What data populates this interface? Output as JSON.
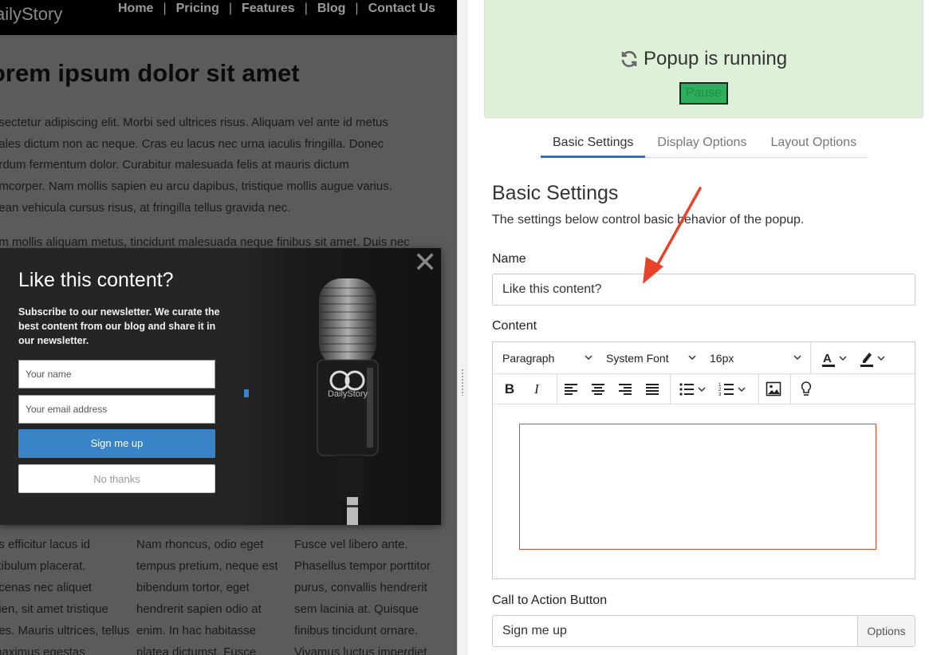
{
  "preview": {
    "logo": "ailyStory",
    "nav": [
      "Home",
      "Pricing",
      "Features",
      "Blog",
      "Contact Us"
    ],
    "nav_separator": "|",
    "article_title": "orem ipsum dolor sit amet",
    "p1_lines": [
      "nsectetur adipiscing elit. Morbi sed ultrices risus. Aliquam vel ante id metus",
      "dales dictum non ac neque. Cras eu lacus nec urna iaculis fringilla. Donec",
      "erdum fermentum dolor. Curabitur malesuada felis at mauris dictum",
      "amcorper. Nam mollis sapien eu arcu dapibus, tristique mollis augue varius.",
      "nean vehicula cursus risus, at fringilla tellus gravida nec."
    ],
    "p2_lines": [
      "am mollis aliquam metus, tincidunt malesuada neque finibus sit amet. Duis nec"
    ],
    "col1_lines": [
      "as efficitur lacus id",
      "stibulum placerat.",
      "ecenas nec aliquet",
      "pien, sit amet tristique",
      "pes. Mauris ultrices, tellus",
      "maximus egestas"
    ],
    "col2_lines": [
      "Nam rhoncus, odio eget",
      "tempus pretium, neque est",
      "bibendum tortor, eget",
      "hendrerit sapien odio at",
      "enim. In hac habitasse",
      "platea dictumst. Fusce"
    ],
    "col3_lines": [
      "Fusce vel libero ante.",
      "Phasellus tempor porttitor",
      "purus, convallis hendrerit",
      "sem lacinia at. Quisque",
      "finibus tincidunt ornare.",
      "Vivamus luctus imperdiet"
    ],
    "popup": {
      "close": "✕",
      "title": "Like this content?",
      "description": "Subscribe to our newsletter. We curate the best content from our blog and share it in our newsletter.",
      "name_placeholder": "Your name",
      "email_placeholder": "Your email address",
      "signup_label": "Sign me up",
      "nothanks_label": "No thanks",
      "brand_text": "DailyStory"
    }
  },
  "status": {
    "icon": "refresh-icon",
    "text": "Popup is running",
    "pause_label": "Pause",
    "background": "#dff0d8"
  },
  "tabs": [
    {
      "label": "Basic Settings",
      "active": true
    },
    {
      "label": "Display Options",
      "active": false
    },
    {
      "label": "Layout Options",
      "active": false
    }
  ],
  "settings": {
    "title": "Basic Settings",
    "description": "The settings below control basic behavior of the popup.",
    "name_label": "Name",
    "name_value": "Like this content?",
    "content_label": "Content",
    "editor": {
      "block_format": "Paragraph",
      "font_family": "System Font",
      "font_size": "16px"
    },
    "cta_label": "Call to Action Button",
    "cta_value": "Sign me up",
    "cta_options": "Options"
  },
  "colors": {
    "accent": "#2a6fd6",
    "pause_button": "#2eae5d",
    "signup_button": "#3b83c7",
    "annotation_arrow": "#e8432a",
    "editor_highlight": "#e04a2a"
  }
}
